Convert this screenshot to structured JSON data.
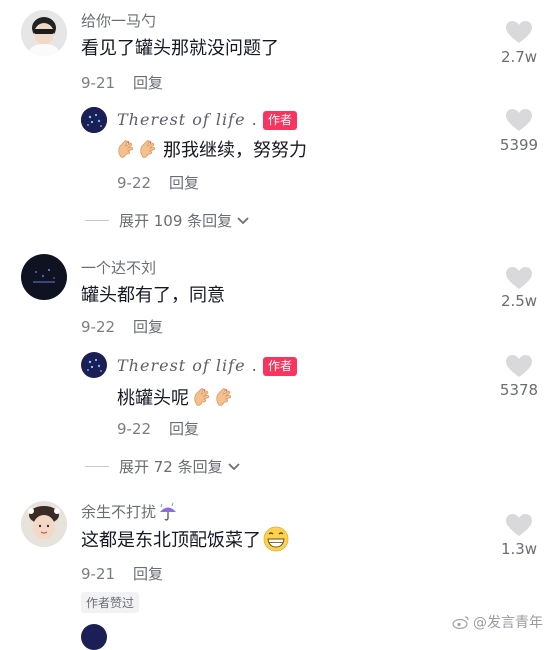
{
  "comments": [
    {
      "username": "给你一马勺",
      "text": "看见了罐头那就没问题了",
      "date": "9-21",
      "reply_label": "回复",
      "likes": "2.7w",
      "reply": {
        "username": "Therest of life .",
        "author_badge": "作者",
        "text": "那我继续，努努力",
        "date": "9-22",
        "reply_label": "回复",
        "likes": "5399"
      },
      "expand_label": "展开 109 条回复"
    },
    {
      "username": "一个达不刘",
      "text": "罐头都有了，同意",
      "date": "9-22",
      "reply_label": "回复",
      "likes": "2.5w",
      "reply": {
        "username": "Therest of life .",
        "author_badge": "作者",
        "text": "桃罐头呢",
        "date": "9-22",
        "reply_label": "回复",
        "likes": "5378"
      },
      "expand_label": "展开 72 条回复"
    },
    {
      "username": "余生不打扰",
      "text": "这都是东北顶配饭菜了",
      "date": "9-21",
      "reply_label": "回复",
      "likes": "1.3w",
      "author_liked": "作者赞过"
    }
  ],
  "watermark": "@发言青年",
  "icons": {
    "heart": "heart-outline-icon",
    "expand": "chevron-down-icon",
    "emoji_hands": "heart-hands-emoji",
    "emoji_grin": "grinning-face-emoji",
    "emoji_umbrella": "umbrella-rain-emoji",
    "weibo": "weibo-logo-icon"
  },
  "colors": {
    "author_badge": "#f8355f",
    "text": "#161823",
    "secondary": "#6b6d74"
  }
}
